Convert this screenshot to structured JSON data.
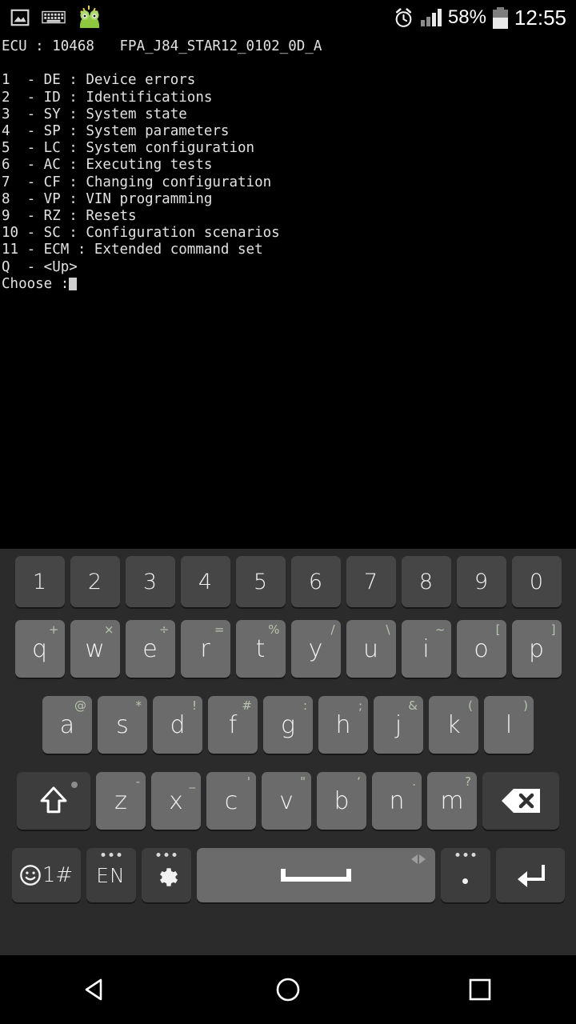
{
  "statusbar": {
    "left_icons": [
      "photo-icon",
      "keyboard-icon",
      "frog-avatar-icon"
    ],
    "alarm_icon": "alarm-clock-icon",
    "signal_icon": "signal-bars-icon",
    "battery_percent": "58%",
    "battery_icon": "battery-icon",
    "clock": "12:55"
  },
  "terminal": {
    "header": "ECU : 10468   FPA_J84_STAR12_0102_0D_A",
    "lines": [
      "1  - DE : Device errors",
      "2  - ID : Identifications",
      "3  - SY : System state",
      "4  - SP : System parameters",
      "5  - LC : System configuration",
      "6  - AC : Executing tests",
      "7  - CF : Changing configuration",
      "8  - VP : VIN programming",
      "9  - RZ : Resets",
      "10 - SC : Configuration scenarios",
      "11 - ECM : Extended command set",
      "Q  - <Up>"
    ],
    "prompt": "Choose :",
    "text_color": "#e2e2e2",
    "background": "#000000"
  },
  "keyboard": {
    "background": "#2b2b2b",
    "number_key_color": "#464646",
    "letter_key_color": "#6b6b6b",
    "function_key_color": "#3d3d3d",
    "alt_label_color": "#b9c4ad",
    "number_row": [
      {
        "label": "1"
      },
      {
        "label": "2"
      },
      {
        "label": "3"
      },
      {
        "label": "4"
      },
      {
        "label": "5"
      },
      {
        "label": "6"
      },
      {
        "label": "7"
      },
      {
        "label": "8"
      },
      {
        "label": "9"
      },
      {
        "label": "0"
      }
    ],
    "row_q": [
      {
        "label": "q",
        "alt": "+"
      },
      {
        "label": "w",
        "alt": "×"
      },
      {
        "label": "e",
        "alt": "÷"
      },
      {
        "label": "r",
        "alt": "="
      },
      {
        "label": "t",
        "alt": "%"
      },
      {
        "label": "y",
        "alt": "/"
      },
      {
        "label": "u",
        "alt": "\\"
      },
      {
        "label": "i",
        "alt": "~"
      },
      {
        "label": "o",
        "alt": "["
      },
      {
        "label": "p",
        "alt": "]"
      }
    ],
    "row_a": [
      {
        "label": "a",
        "alt": "@"
      },
      {
        "label": "s",
        "alt": "*"
      },
      {
        "label": "d",
        "alt": "!"
      },
      {
        "label": "f",
        "alt": "#"
      },
      {
        "label": "g",
        "alt": ":"
      },
      {
        "label": "h",
        "alt": ";"
      },
      {
        "label": "j",
        "alt": "&"
      },
      {
        "label": "k",
        "alt": "("
      },
      {
        "label": "l",
        "alt": ")"
      }
    ],
    "row_z": [
      {
        "label": "z",
        "alt": "-"
      },
      {
        "label": "x",
        "alt": "_"
      },
      {
        "label": "c",
        "alt": "'"
      },
      {
        "label": "v",
        "alt": "\""
      },
      {
        "label": "b",
        "alt": "‘"
      },
      {
        "label": "n",
        "alt": "."
      },
      {
        "label": "m",
        "alt": "?"
      }
    ],
    "shift_key": "shift-key",
    "backspace_key": "backspace-key",
    "bottom_row": {
      "symbols_label": "1#",
      "language_label": "EN",
      "settings_icon": "gear-icon",
      "space_label": "space-key",
      "period_label": ".",
      "enter_label": "enter-key"
    }
  },
  "navbar": {
    "back": "back-button",
    "home": "home-button",
    "recents": "recents-button"
  }
}
